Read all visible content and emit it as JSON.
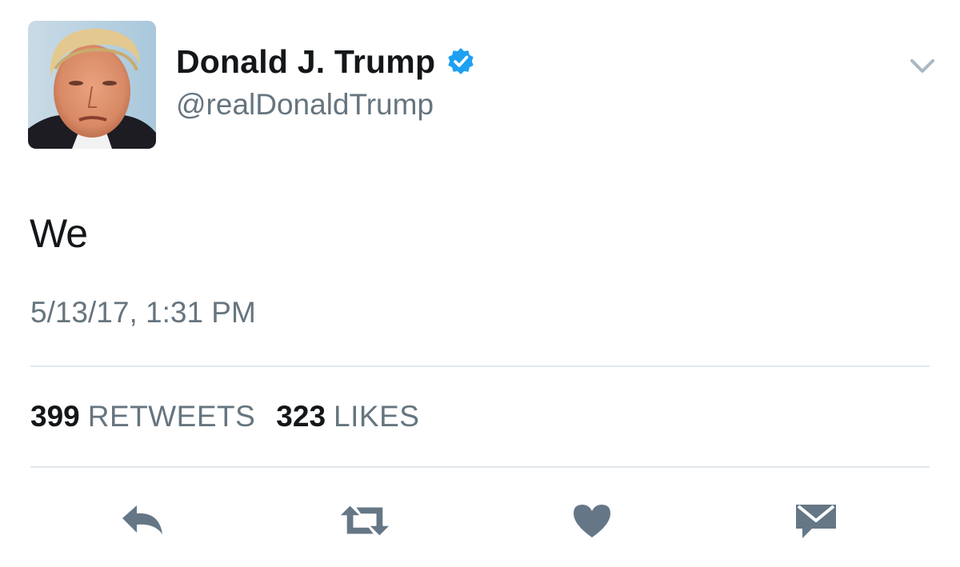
{
  "author": {
    "display_name": "Donald J. Trump",
    "handle": "@realDonaldTrump",
    "verified": true,
    "verified_color": "#1da1f2"
  },
  "tweet": {
    "text": "We",
    "timestamp": "5/13/17, 1:31 PM"
  },
  "stats": {
    "retweets_count": "399",
    "retweets_label": "RETWEETS",
    "likes_count": "323",
    "likes_label": "LIKES"
  },
  "actions": [
    {
      "name": "reply",
      "icon": "reply-icon"
    },
    {
      "name": "retweet",
      "icon": "retweet-icon"
    },
    {
      "name": "like",
      "icon": "heart-icon"
    },
    {
      "name": "direct-message",
      "icon": "envelope-icon"
    }
  ],
  "colors": {
    "text_primary": "#14171a",
    "text_secondary": "#66757f",
    "icon": "#657786",
    "divider": "#e1e8ed"
  }
}
